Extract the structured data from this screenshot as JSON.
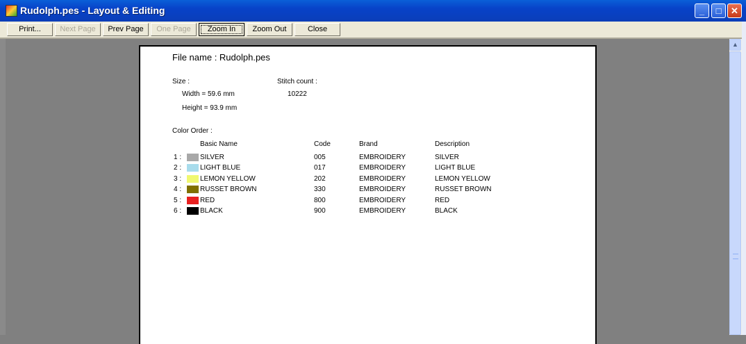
{
  "window": {
    "title": "Rudolph.pes - Layout & Editing"
  },
  "toolbar": {
    "print": "Print...",
    "next_page": "Next Page",
    "prev_page": "Prev Page",
    "one_page": "One Page",
    "zoom_in": "Zoom In",
    "zoom_out": "Zoom Out",
    "close": "Close"
  },
  "page": {
    "file_name": "File name : Rudolph.pes",
    "size_label": "Size :",
    "width": "Width  = 59.6 mm",
    "height": "Height = 93.9 mm",
    "stitch_label": "Stitch count :",
    "stitch_count": "10222",
    "color_order_label": "Color Order :",
    "headers": {
      "name": "Basic Name",
      "code": "Code",
      "brand": "Brand",
      "description": "Description"
    },
    "colors": [
      {
        "num": "1 :",
        "name": "SILVER",
        "code": "005",
        "brand": "EMBROIDERY",
        "description": "SILVER",
        "swatch": "#a8a8a8"
      },
      {
        "num": "2 :",
        "name": "LIGHT BLUE",
        "code": "017",
        "brand": "EMBROIDERY",
        "description": "LIGHT BLUE",
        "swatch": "#a8dcec"
      },
      {
        "num": "3 :",
        "name": "LEMON YELLOW",
        "code": "202",
        "brand": "EMBROIDERY",
        "description": "LEMON YELLOW",
        "swatch": "#f0f870"
      },
      {
        "num": "4 :",
        "name": "RUSSET BROWN",
        "code": "330",
        "brand": "EMBROIDERY",
        "description": "RUSSET BROWN",
        "swatch": "#807000"
      },
      {
        "num": "5 :",
        "name": "RED",
        "code": "800",
        "brand": "EMBROIDERY",
        "description": "RED",
        "swatch": "#e82020"
      },
      {
        "num": "6 :",
        "name": "BLACK",
        "code": "900",
        "brand": "EMBROIDERY",
        "description": "BLACK",
        "swatch": "#000000"
      }
    ]
  }
}
